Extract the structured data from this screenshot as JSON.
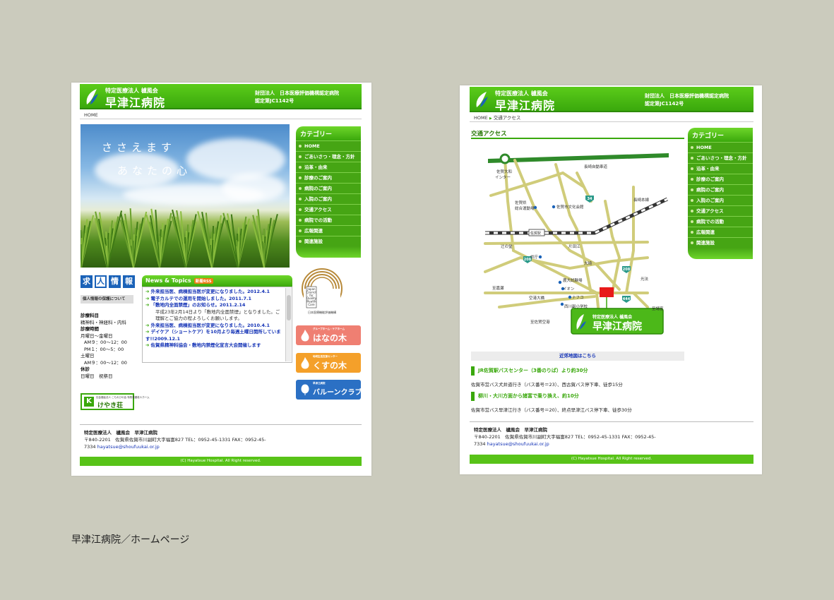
{
  "caption": "早津江病院／ホームページ",
  "site": {
    "subtitle": "特定医療法人 櫨風会",
    "name": "早津江病院",
    "cert_line1": "財団法人　日本医療評価機構認定病院",
    "cert_line2": "認定第JC1142号"
  },
  "home": {
    "breadcrumb": "HOME",
    "hero_line1": "ささえます",
    "hero_line2": "あなたの心",
    "recruit": [
      "求",
      "人",
      "情",
      "報"
    ],
    "privacy": "個人情報の保護について",
    "info": [
      {
        "text": "診療科目",
        "bold": true
      },
      {
        "text": "精神科・神経科・内科",
        "bold": false
      },
      {
        "text": "診療時間",
        "bold": true
      },
      {
        "text": "月曜日〜金曜日",
        "bold": false
      },
      {
        "text": "AM９：00〜12：00",
        "bold": false
      },
      {
        "text": "PM１：00〜5：00",
        "bold": false
      },
      {
        "text": "土曜日",
        "bold": false
      },
      {
        "text": "AM９：00〜12：00",
        "bold": false
      },
      {
        "text": "休診",
        "bold": true
      },
      {
        "text": "日曜日　祝祭日",
        "bold": false
      }
    ],
    "keyaki_small": "社会福祉法人 こもれびの会 特別養護老人ホーム",
    "keyaki_name": "けやき荘",
    "news_title": "News & Topics",
    "rss": "新着RSS",
    "news": [
      {
        "title": "外来担当医、病棟担当医が変更になりました。2012.4.1",
        "detail": ""
      },
      {
        "title": "電子カルテでの運用を開始しました。2011.7.1",
        "detail": ""
      },
      {
        "title": "「敷地内全面禁煙」のお知らせ。2011.2.14",
        "detail": "平成23年2月14日より「敷地内全面禁煙」となりました。ご理解とご協力の程よろしくお願いします。"
      },
      {
        "title": "外来担当医、病棟担当医が変更になりました。2010.4.1",
        "detail": ""
      },
      {
        "title": "デイケア（ショートケア）を10月より毎週土曜日開所しています!!2009.12.1",
        "detail": ""
      },
      {
        "title": "佐賀県精神科協会・敷地内禁煙化宣言大会開催します",
        "detail": ""
      }
    ],
    "seal_en": [
      "Japan",
      "Council",
      "for",
      "Quality",
      "Health",
      "Care"
    ],
    "seal_jp": "日本医療機能評価機構",
    "banners": [
      {
        "small": "グループホーム・ケアホーム",
        "name": "はなの木"
      },
      {
        "small": "地域生活支援センター",
        "name": "くすの木"
      },
      {
        "small": "早津江病院",
        "name": "バルーンクラブ"
      }
    ]
  },
  "categories": {
    "title": "カテゴリー",
    "items": [
      "HOME",
      "ごあいさつ・理念・方針",
      "沿革・由来",
      "診療のご案内",
      "病院のご案内",
      "入院のご案内",
      "交通アクセス",
      "病院での活動",
      "広報関連",
      "関連施設"
    ]
  },
  "footer": {
    "org": "特定医療法人　櫨風会　早津江病院",
    "address": "〒840-2201　佐賀県佐賀市川副町大字福富827 TEL：0952-45-1331 FAX：0952-45-",
    "address2": "7334",
    "email": "hayatsue@shoufuukai.or.jp",
    "copyright": "(C) Hayatsue Hospital. All Right reserved."
  },
  "access": {
    "breadcrumb_home": "HOME",
    "breadcrumb_sep": "▶",
    "breadcrumb_current": "交通アクセス",
    "title": "交通アクセス",
    "map_labels": {
      "inter": "佐賀大和",
      "inter2": "インター",
      "expressway": "長崎自動車道",
      "nagasaki_line": "長崎本線",
      "sports1": "佐賀県",
      "sports2": "総合運動場",
      "culture": "佐賀市文化会館",
      "saga_station": "佐賀駅",
      "tsujinodo": "辻の堂",
      "katataе": "片田江",
      "city_office": "県庁",
      "osaki": "大崎",
      "shijima": "至嘉瀬",
      "nouson": "農大試験場",
      "aeon": "イオン",
      "nafuko": "ナフコ",
      "airport_road": "空港大橋",
      "nishikawazoe": "西川副小学校",
      "kobashi": "光法",
      "shifukudomi": "至諸富",
      "shisaga_airport": "至佐賀空港",
      "r34": "34",
      "r208a": "208",
      "r208b": "208",
      "r444": "444"
    },
    "near_map": "近郊地図はこちら",
    "route1_head": "JR佐賀駅バスセンター（3番のりば）より約30分",
    "route1_body": "佐賀市営バス犬井道行き（バス番号＝23）、西古賀バス停下車、徒歩15分",
    "route2_head": "柳川・大川方面から諸富で乗り換え、約10分",
    "route2_body": "佐賀市営バス早津江行き（バス番号＝20）、終点早津江バス停下車、徒歩30分"
  },
  "colors": {
    "brand_green": "#3aa80c",
    "link_blue": "#1433b6",
    "background": "#cbcbbd"
  }
}
